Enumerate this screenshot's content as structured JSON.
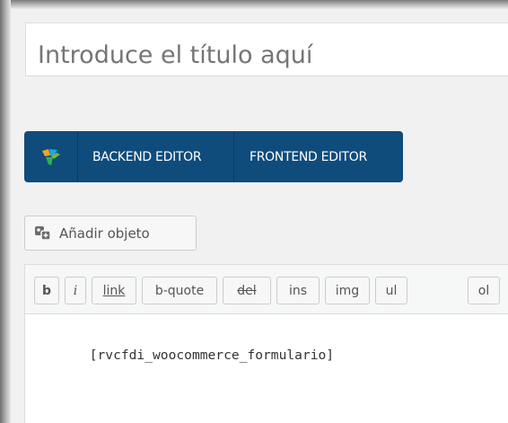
{
  "title": {
    "placeholder": "Introduce el título aquí"
  },
  "page_builder": {
    "backend_label": "BACKEND EDITOR",
    "frontend_label": "FRONTEND EDITOR",
    "background": "#0f4c7c",
    "logo_icon": "visual-composer-logo-icon"
  },
  "media": {
    "add_label": "Añadir objeto",
    "icon": "add-media-icon"
  },
  "quicktags": [
    {
      "label": "b"
    },
    {
      "label": "i"
    },
    {
      "label": "link"
    },
    {
      "label": "b-quote"
    },
    {
      "label": "del"
    },
    {
      "label": "ins"
    },
    {
      "label": "img"
    },
    {
      "label": "ul"
    },
    {
      "label": "ol"
    }
  ],
  "editor": {
    "content": "[rvcfdi_woocommerce_formulario]"
  }
}
